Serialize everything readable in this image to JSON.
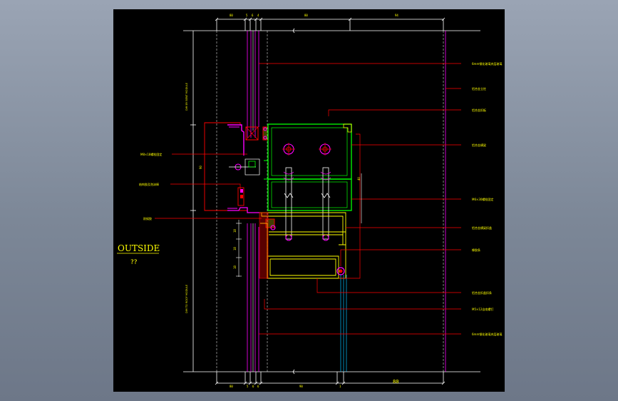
{
  "drawing": {
    "outside_label": "OUTSIDE",
    "outside_sub": "??",
    "colors": {
      "background": "#000000",
      "dimension": "#ffffff",
      "leader": "#ff0000",
      "glass": "#ff00ff",
      "aluminum": "#00ff00",
      "profile": "#ffff00",
      "text": "#ffff00",
      "waterline": "#00bfff"
    },
    "dims_top": [
      "80",
      "5",
      "6",
      "4",
      "80",
      "94"
    ],
    "dims_bottom": [
      "80",
      "5",
      "6",
      "6",
      "90",
      "1",
      "80"
    ],
    "dims_left_vertical": [
      "80",
      "18",
      "18",
      "18"
    ],
    "dim_right_vertical": [
      "40"
    ],
    "left_callouts": [
      "M8×18螺栓固定",
      "结构胶及泡沫棒",
      "耐候胶"
    ],
    "right_callouts": [
      "6mm钢化玻璃夹层玻璃",
      "铝合金立柱",
      "铝合金扣板",
      "铝合金横梁",
      "M6×30螺栓固定",
      "铝合金横梁扣盖",
      "橡胶条",
      "铝合金扣盖扣条",
      "M5×12自攻螺钉",
      "6mm钢化玻璃夹层玻璃"
    ],
    "vertical_texts": [
      "DIM BY BENT MODULE",
      "DIM TO ROOF MODULE"
    ],
    "dim_vertical_left": "90"
  }
}
